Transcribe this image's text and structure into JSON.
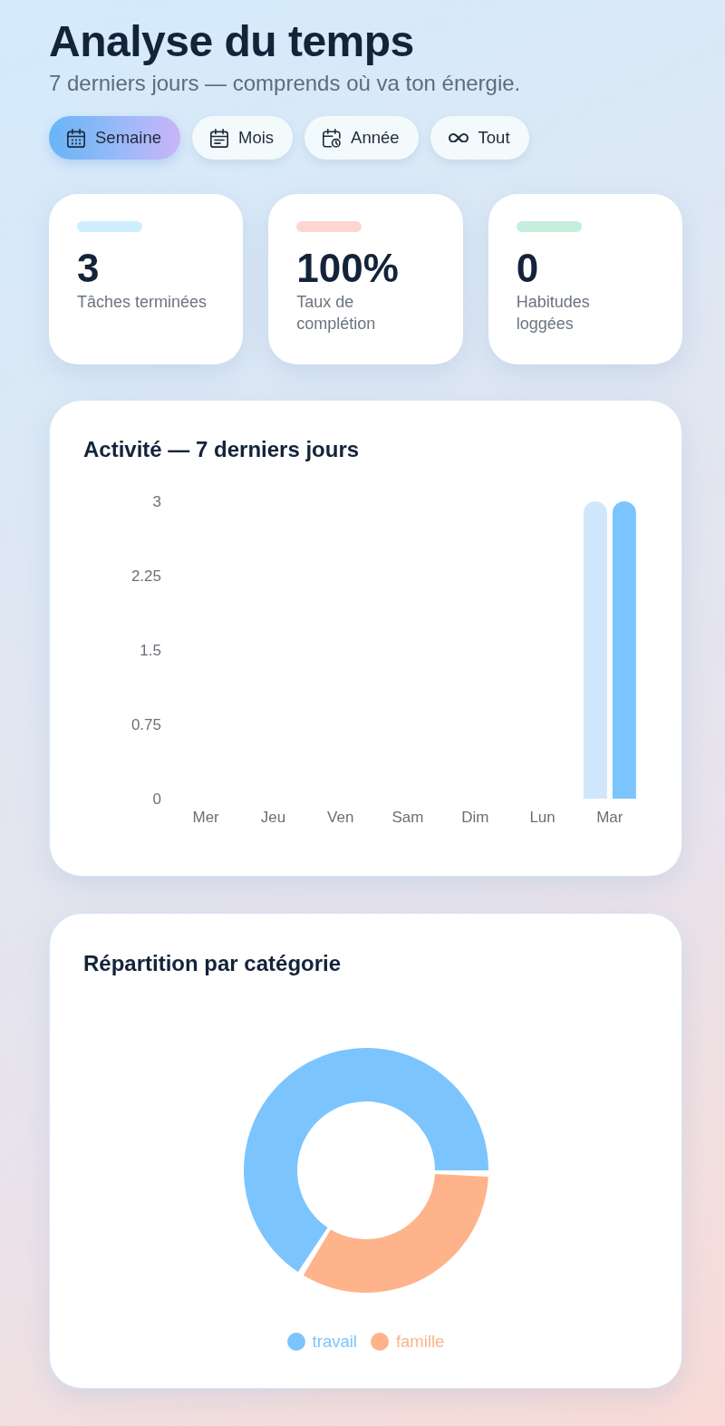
{
  "header": {
    "title": "Analyse du temps",
    "subtitle": "7 derniers jours — comprends où va ton énergie."
  },
  "tabs": [
    {
      "label": "Semaine",
      "kind": "week",
      "selected": true
    },
    {
      "label": "Mois",
      "kind": "month",
      "selected": false
    },
    {
      "label": "Année",
      "kind": "year",
      "selected": false
    },
    {
      "label": "Tout",
      "kind": "all",
      "selected": false
    }
  ],
  "stats": [
    {
      "value": "3",
      "label": "Tâches terminées",
      "color": "#cdeefe"
    },
    {
      "value": "100%",
      "label": "Taux de complétion",
      "color": "#fdd6d0"
    },
    {
      "value": "0",
      "label": "Habitudes loggées",
      "color": "#c6eedd"
    }
  ],
  "activity": {
    "title": "Activité — 7 derniers jours",
    "chart_data": {
      "type": "bar",
      "categories": [
        "Mer",
        "Jeu",
        "Ven",
        "Sam",
        "Dim",
        "Lun",
        "Mar"
      ],
      "series": [
        {
          "color": "#d0e6fb",
          "values": [
            0,
            0,
            0,
            0,
            0,
            0,
            3
          ]
        },
        {
          "color": "#7cc4fd",
          "values": [
            0,
            0,
            0,
            0,
            0,
            0,
            3
          ]
        }
      ],
      "ylim": [
        0,
        3
      ],
      "yticks": [
        {
          "value": 0,
          "label": "0"
        },
        {
          "value": 0.75,
          "label": "0.75"
        },
        {
          "value": 1.5,
          "label": "1.5"
        },
        {
          "value": 2.25,
          "label": "2.25"
        },
        {
          "value": 3,
          "label": "3"
        }
      ]
    }
  },
  "breakdown": {
    "title": "Répartition par catégorie",
    "chart_data": {
      "type": "donut",
      "categories": [
        "travail",
        "famille"
      ],
      "values": [
        66.7,
        33.3
      ],
      "colors": [
        "#7cc4fd",
        "#feb38b"
      ],
      "legend": "bottom"
    }
  }
}
